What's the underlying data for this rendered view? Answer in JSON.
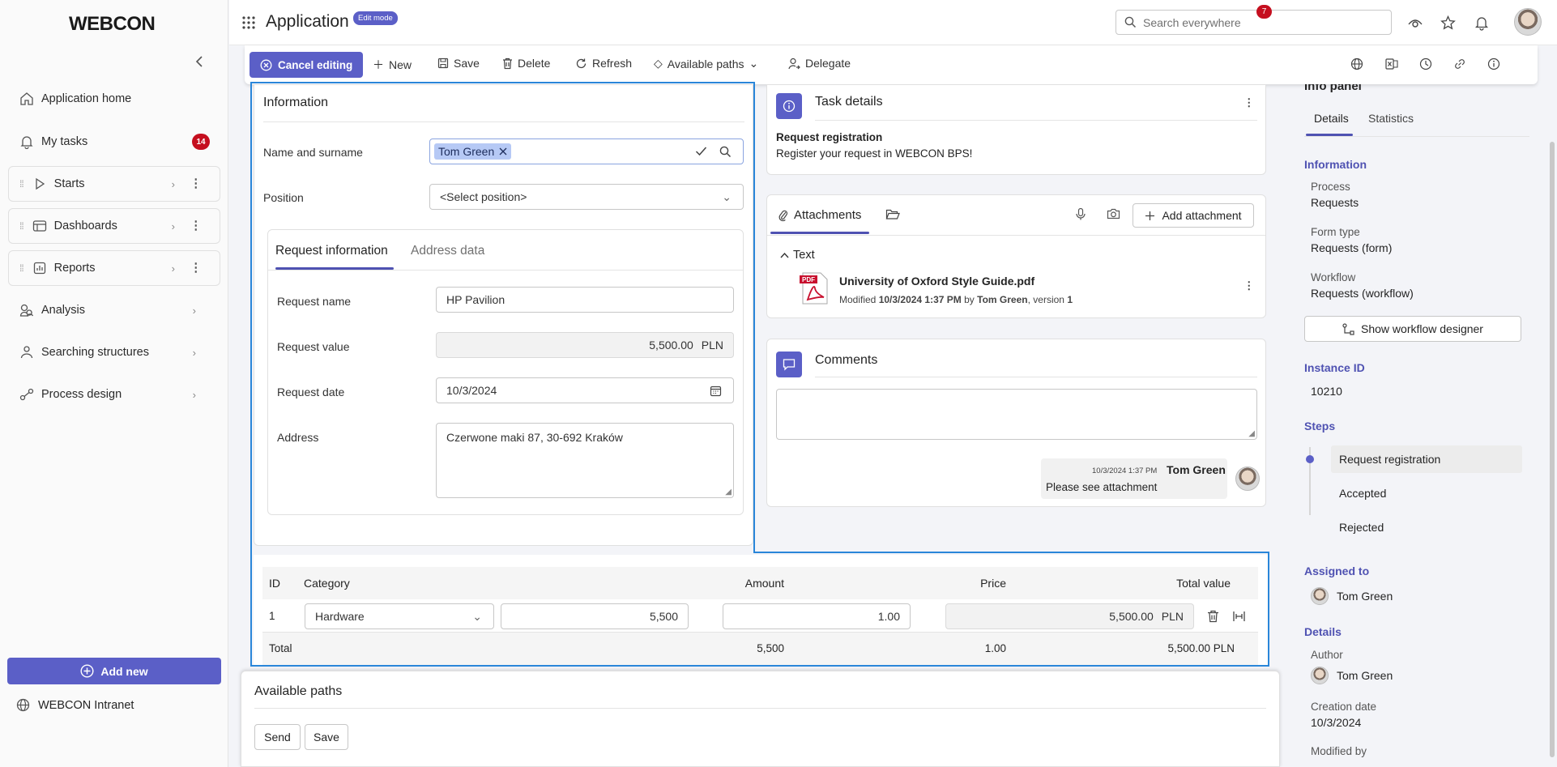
{
  "brand": {
    "logo": "WEBCON"
  },
  "sidebar": {
    "items": [
      {
        "label": "Application home",
        "icon": "home-icon"
      },
      {
        "label": "My tasks",
        "icon": "bell-icon",
        "badge": "14"
      },
      {
        "label": "Starts",
        "icon": "play-icon"
      },
      {
        "label": "Dashboards",
        "icon": "dashboard-icon"
      },
      {
        "label": "Reports",
        "icon": "report-icon"
      },
      {
        "label": "Analysis",
        "icon": "analysis-icon"
      },
      {
        "label": "Searching structures",
        "icon": "structure-icon"
      },
      {
        "label": "Process design",
        "icon": "process-icon"
      }
    ],
    "add_new": "Add new",
    "intranet": "WEBCON Intranet"
  },
  "header": {
    "title": "Application",
    "mode_badge": "Edit mode",
    "search_placeholder": "Search everywhere",
    "notifications": "7"
  },
  "toolbar": {
    "cancel": "Cancel editing",
    "new": "New",
    "save": "Save",
    "delete": "Delete",
    "refresh": "Refresh",
    "paths": "Available paths",
    "delegate": "Delegate"
  },
  "information": {
    "title": "Information",
    "name_label": "Name and surname",
    "name_value": "Tom Green",
    "position_label": "Position",
    "position_value": "<Select position>",
    "tabs": [
      "Request information",
      "Address data"
    ],
    "fields": {
      "request_name_label": "Request name",
      "request_name": "HP Pavilion",
      "request_value_label": "Request value",
      "request_value": "5,500.00",
      "currency": "PLN",
      "request_date_label": "Request date",
      "request_date": "10/3/2024",
      "address_label": "Address",
      "address": "Czerwone maki 87, 30-692 Kraków"
    }
  },
  "task": {
    "title": "Task details",
    "step": "Request registration",
    "description": "Register your request in WEBCON BPS!"
  },
  "attachments": {
    "tab": "Attachments",
    "add": "Add attachment",
    "group": "Text",
    "file": "University of Oxford Style Guide.pdf",
    "modified_prefix": "Modified",
    "modified_date": "10/3/2024 1:37 PM",
    "by": "by",
    "author": "Tom Green",
    "version_prefix": ", version",
    "version": "1"
  },
  "comments": {
    "title": "Comments",
    "time": "10/3/2024 1:37 PM",
    "author": "Tom Green",
    "text": "Please see attachment"
  },
  "table": {
    "headers": [
      "ID",
      "Category",
      "Amount",
      "Price",
      "Total value"
    ],
    "row": {
      "id": "1",
      "category": "Hardware",
      "amount": "5,500",
      "price": "1.00",
      "total": "5,500.00",
      "currency": "PLN"
    },
    "total": {
      "label": "Total",
      "amount": "5,500",
      "price": "1.00",
      "total": "5,500.00 PLN"
    }
  },
  "paths": {
    "title": "Available paths",
    "send": "Send",
    "save": "Save"
  },
  "info_panel": {
    "title": "Info panel",
    "tabs": [
      "Details",
      "Statistics"
    ],
    "information": "Information",
    "process_label": "Process",
    "process": "Requests",
    "form_type_label": "Form type",
    "form_type": "Requests (form)",
    "workflow_label": "Workflow",
    "workflow": "Requests (workflow)",
    "show_designer": "Show workflow designer",
    "instance_label": "Instance ID",
    "instance": "10210",
    "steps_label": "Steps",
    "steps": [
      "Request registration",
      "Accepted",
      "Rejected"
    ],
    "assigned_label": "Assigned to",
    "assigned": "Tom Green",
    "details_label": "Details",
    "author_label": "Author",
    "author": "Tom Green",
    "creation_label": "Creation date",
    "creation": "10/3/2024",
    "modified_label": "Modified by"
  },
  "colors": {
    "accent": "#5b5fc7",
    "badge": "#c50f1f",
    "selection": "#2a86d9"
  }
}
